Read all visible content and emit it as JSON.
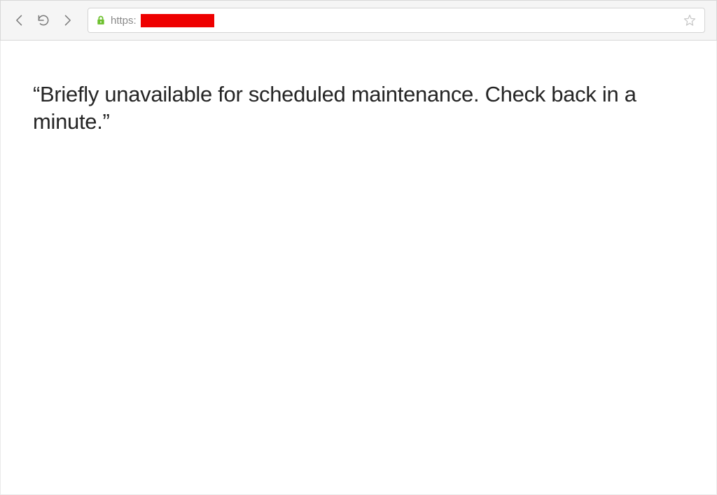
{
  "browser": {
    "url_prefix": "https:"
  },
  "page": {
    "message": "“Briefly unavailable for scheduled maintenance. Check back in a minute.”"
  }
}
